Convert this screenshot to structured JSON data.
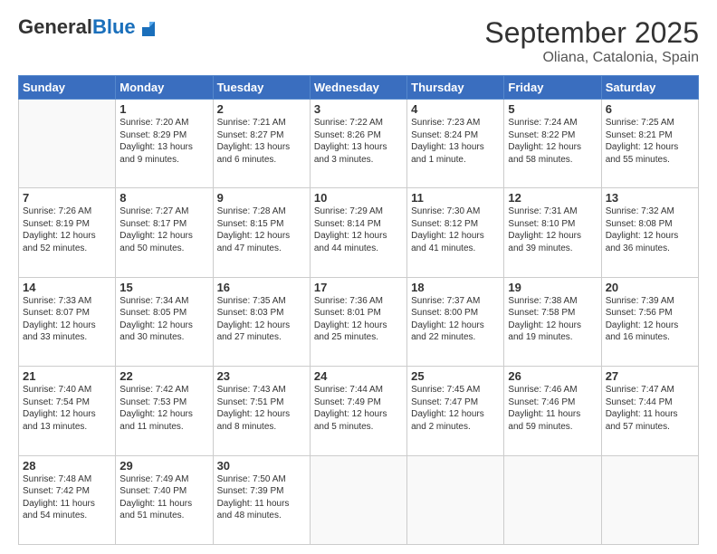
{
  "header": {
    "logo_general": "General",
    "logo_blue": "Blue",
    "title": "September 2025",
    "subtitle": "Oliana, Catalonia, Spain"
  },
  "weekdays": [
    "Sunday",
    "Monday",
    "Tuesday",
    "Wednesday",
    "Thursday",
    "Friday",
    "Saturday"
  ],
  "weeks": [
    [
      {
        "day": "",
        "sunrise": "",
        "sunset": "",
        "daylight": ""
      },
      {
        "day": "1",
        "sunrise": "Sunrise: 7:20 AM",
        "sunset": "Sunset: 8:29 PM",
        "daylight": "Daylight: 13 hours and 9 minutes."
      },
      {
        "day": "2",
        "sunrise": "Sunrise: 7:21 AM",
        "sunset": "Sunset: 8:27 PM",
        "daylight": "Daylight: 13 hours and 6 minutes."
      },
      {
        "day": "3",
        "sunrise": "Sunrise: 7:22 AM",
        "sunset": "Sunset: 8:26 PM",
        "daylight": "Daylight: 13 hours and 3 minutes."
      },
      {
        "day": "4",
        "sunrise": "Sunrise: 7:23 AM",
        "sunset": "Sunset: 8:24 PM",
        "daylight": "Daylight: 13 hours and 1 minute."
      },
      {
        "day": "5",
        "sunrise": "Sunrise: 7:24 AM",
        "sunset": "Sunset: 8:22 PM",
        "daylight": "Daylight: 12 hours and 58 minutes."
      },
      {
        "day": "6",
        "sunrise": "Sunrise: 7:25 AM",
        "sunset": "Sunset: 8:21 PM",
        "daylight": "Daylight: 12 hours and 55 minutes."
      }
    ],
    [
      {
        "day": "7",
        "sunrise": "Sunrise: 7:26 AM",
        "sunset": "Sunset: 8:19 PM",
        "daylight": "Daylight: 12 hours and 52 minutes."
      },
      {
        "day": "8",
        "sunrise": "Sunrise: 7:27 AM",
        "sunset": "Sunset: 8:17 PM",
        "daylight": "Daylight: 12 hours and 50 minutes."
      },
      {
        "day": "9",
        "sunrise": "Sunrise: 7:28 AM",
        "sunset": "Sunset: 8:15 PM",
        "daylight": "Daylight: 12 hours and 47 minutes."
      },
      {
        "day": "10",
        "sunrise": "Sunrise: 7:29 AM",
        "sunset": "Sunset: 8:14 PM",
        "daylight": "Daylight: 12 hours and 44 minutes."
      },
      {
        "day": "11",
        "sunrise": "Sunrise: 7:30 AM",
        "sunset": "Sunset: 8:12 PM",
        "daylight": "Daylight: 12 hours and 41 minutes."
      },
      {
        "day": "12",
        "sunrise": "Sunrise: 7:31 AM",
        "sunset": "Sunset: 8:10 PM",
        "daylight": "Daylight: 12 hours and 39 minutes."
      },
      {
        "day": "13",
        "sunrise": "Sunrise: 7:32 AM",
        "sunset": "Sunset: 8:08 PM",
        "daylight": "Daylight: 12 hours and 36 minutes."
      }
    ],
    [
      {
        "day": "14",
        "sunrise": "Sunrise: 7:33 AM",
        "sunset": "Sunset: 8:07 PM",
        "daylight": "Daylight: 12 hours and 33 minutes."
      },
      {
        "day": "15",
        "sunrise": "Sunrise: 7:34 AM",
        "sunset": "Sunset: 8:05 PM",
        "daylight": "Daylight: 12 hours and 30 minutes."
      },
      {
        "day": "16",
        "sunrise": "Sunrise: 7:35 AM",
        "sunset": "Sunset: 8:03 PM",
        "daylight": "Daylight: 12 hours and 27 minutes."
      },
      {
        "day": "17",
        "sunrise": "Sunrise: 7:36 AM",
        "sunset": "Sunset: 8:01 PM",
        "daylight": "Daylight: 12 hours and 25 minutes."
      },
      {
        "day": "18",
        "sunrise": "Sunrise: 7:37 AM",
        "sunset": "Sunset: 8:00 PM",
        "daylight": "Daylight: 12 hours and 22 minutes."
      },
      {
        "day": "19",
        "sunrise": "Sunrise: 7:38 AM",
        "sunset": "Sunset: 7:58 PM",
        "daylight": "Daylight: 12 hours and 19 minutes."
      },
      {
        "day": "20",
        "sunrise": "Sunrise: 7:39 AM",
        "sunset": "Sunset: 7:56 PM",
        "daylight": "Daylight: 12 hours and 16 minutes."
      }
    ],
    [
      {
        "day": "21",
        "sunrise": "Sunrise: 7:40 AM",
        "sunset": "Sunset: 7:54 PM",
        "daylight": "Daylight: 12 hours and 13 minutes."
      },
      {
        "day": "22",
        "sunrise": "Sunrise: 7:42 AM",
        "sunset": "Sunset: 7:53 PM",
        "daylight": "Daylight: 12 hours and 11 minutes."
      },
      {
        "day": "23",
        "sunrise": "Sunrise: 7:43 AM",
        "sunset": "Sunset: 7:51 PM",
        "daylight": "Daylight: 12 hours and 8 minutes."
      },
      {
        "day": "24",
        "sunrise": "Sunrise: 7:44 AM",
        "sunset": "Sunset: 7:49 PM",
        "daylight": "Daylight: 12 hours and 5 minutes."
      },
      {
        "day": "25",
        "sunrise": "Sunrise: 7:45 AM",
        "sunset": "Sunset: 7:47 PM",
        "daylight": "Daylight: 12 hours and 2 minutes."
      },
      {
        "day": "26",
        "sunrise": "Sunrise: 7:46 AM",
        "sunset": "Sunset: 7:46 PM",
        "daylight": "Daylight: 11 hours and 59 minutes."
      },
      {
        "day": "27",
        "sunrise": "Sunrise: 7:47 AM",
        "sunset": "Sunset: 7:44 PM",
        "daylight": "Daylight: 11 hours and 57 minutes."
      }
    ],
    [
      {
        "day": "28",
        "sunrise": "Sunrise: 7:48 AM",
        "sunset": "Sunset: 7:42 PM",
        "daylight": "Daylight: 11 hours and 54 minutes."
      },
      {
        "day": "29",
        "sunrise": "Sunrise: 7:49 AM",
        "sunset": "Sunset: 7:40 PM",
        "daylight": "Daylight: 11 hours and 51 minutes."
      },
      {
        "day": "30",
        "sunrise": "Sunrise: 7:50 AM",
        "sunset": "Sunset: 7:39 PM",
        "daylight": "Daylight: 11 hours and 48 minutes."
      },
      {
        "day": "",
        "sunrise": "",
        "sunset": "",
        "daylight": ""
      },
      {
        "day": "",
        "sunrise": "",
        "sunset": "",
        "daylight": ""
      },
      {
        "day": "",
        "sunrise": "",
        "sunset": "",
        "daylight": ""
      },
      {
        "day": "",
        "sunrise": "",
        "sunset": "",
        "daylight": ""
      }
    ]
  ]
}
